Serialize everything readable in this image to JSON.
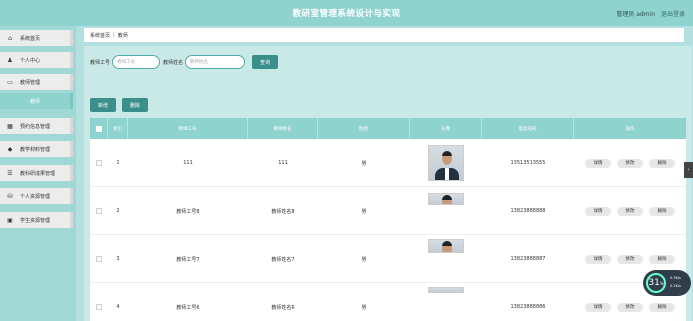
{
  "header": {
    "title": "教研室管理系统设计与实现",
    "role": "管理员 admin",
    "logout": "退出登录"
  },
  "sidebar": {
    "items": [
      {
        "label": "系统首页",
        "icon": "home-icon",
        "glyph": "⌂"
      },
      {
        "label": "个人中心",
        "icon": "user-icon",
        "glyph": "♟"
      },
      {
        "label": "教师管理",
        "icon": "teacher-icon",
        "glyph": "▭"
      },
      {
        "label": "教师",
        "icon": "",
        "glyph": ""
      },
      {
        "label": "预约信息管理",
        "icon": "calendar-icon",
        "glyph": "▦"
      },
      {
        "label": "教学材料管理",
        "icon": "shield-icon",
        "glyph": "◆"
      },
      {
        "label": "教科研成果管理",
        "icon": "document-icon",
        "glyph": "☰"
      },
      {
        "label": "个人资源管理",
        "icon": "resource-icon",
        "glyph": "⛁"
      },
      {
        "label": "学生资源管理",
        "icon": "grid-icon",
        "glyph": "▣"
      }
    ]
  },
  "breadcrumb": {
    "home": "系统首页",
    "sep": "|",
    "current": "教师"
  },
  "search": {
    "id_label": "教师工号",
    "id_placeholder": "教师工号",
    "name_label": "教师姓名",
    "name_placeholder": "教师姓名",
    "button": "查询"
  },
  "actions": {
    "add": "新增",
    "delete": "删除"
  },
  "table": {
    "headers": [
      "索引",
      "教师工号",
      "教师姓名",
      "性别",
      "头像",
      "电话号码",
      "操作"
    ],
    "rows": [
      {
        "index": "1",
        "id": "111",
        "name": "111",
        "gender": "男",
        "phone": "13513513555"
      },
      {
        "index": "2",
        "id": "教师工号8",
        "name": "教师姓名8",
        "gender": "男",
        "phone": "13823888888"
      },
      {
        "index": "3",
        "id": "教师工号7",
        "name": "教师姓名7",
        "gender": "男",
        "phone": "13823888887"
      },
      {
        "index": "4",
        "id": "教师工号6",
        "name": "教师姓名6",
        "gender": "男",
        "phone": "13823888886"
      }
    ],
    "ops": [
      "详情",
      "修改",
      "删除"
    ]
  },
  "widget": {
    "number": "31",
    "percent_sign": "%",
    "up": "0.3K/s",
    "down": "0.2K/s"
  },
  "colors": {
    "accent": "#8fd3cf",
    "button": "#3a8f8a"
  }
}
